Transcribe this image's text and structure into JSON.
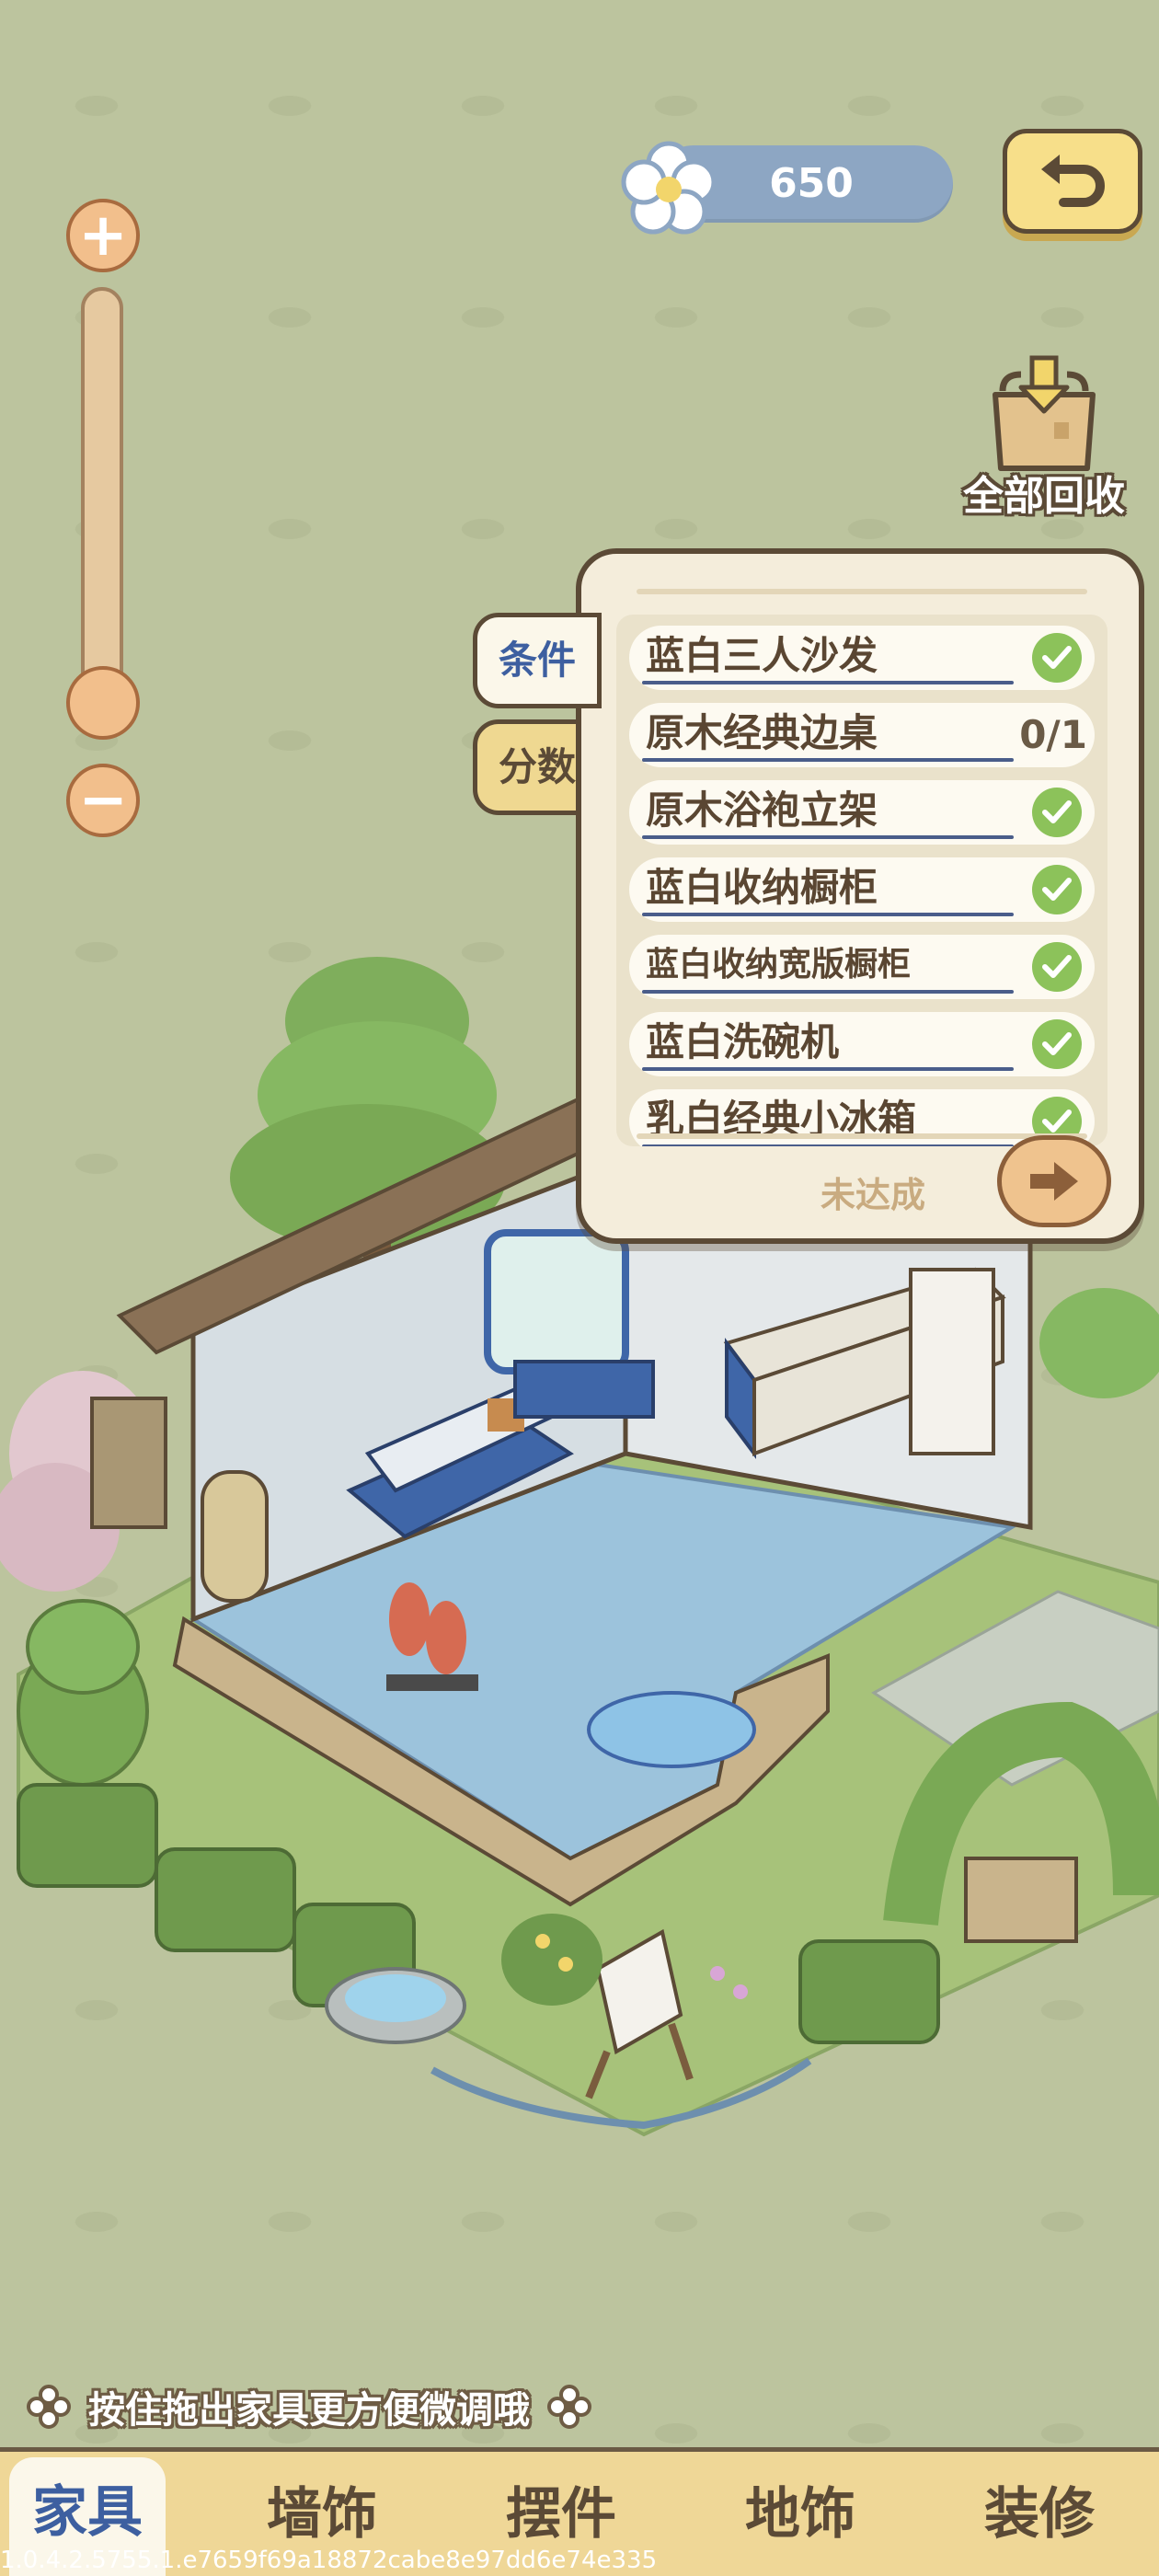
{
  "header": {
    "currency_amount": "650",
    "currency_icon": "flower-icon",
    "back_icon": "undo-arrow-icon"
  },
  "zoom": {
    "plus_label": "+",
    "minus_label": "−",
    "level": 0.05
  },
  "recycle": {
    "label": "全部回收",
    "icon": "shopping-bag-icon"
  },
  "panel": {
    "tabs": [
      {
        "label": "条件",
        "active": true
      },
      {
        "label": "分数",
        "active": false
      }
    ],
    "conditions": [
      {
        "name": "蓝白三人沙发",
        "done": true
      },
      {
        "name": "原木经典边桌",
        "done": false,
        "progress": "0/1"
      },
      {
        "name": "原木浴袍立架",
        "done": true
      },
      {
        "name": "蓝白收纳橱柜",
        "done": true
      },
      {
        "name": "蓝白收纳宽版橱柜",
        "done": true
      },
      {
        "name": "蓝白洗碗机",
        "done": true
      },
      {
        "name": "乳白经典小冰箱",
        "done": true
      }
    ],
    "status": "未达成",
    "go_icon": "arrow-right-icon"
  },
  "hint": {
    "text": "按住拖出家具更方便微调哦"
  },
  "bottom_nav": {
    "tabs": [
      {
        "label": "家具",
        "active": true
      },
      {
        "label": "墙饰",
        "active": false
      },
      {
        "label": "摆件",
        "active": false
      },
      {
        "label": "地饰",
        "active": false
      },
      {
        "label": "装修",
        "active": false
      }
    ]
  },
  "version": "1.0.4.2.5755.1.e7659f69a18872cabe8e97dd6e74e335",
  "colors": {
    "background": "#bcc49e",
    "accent_blue": "#3d5fa0",
    "check_green": "#8cc25a",
    "nav_bar": "#efd797"
  }
}
